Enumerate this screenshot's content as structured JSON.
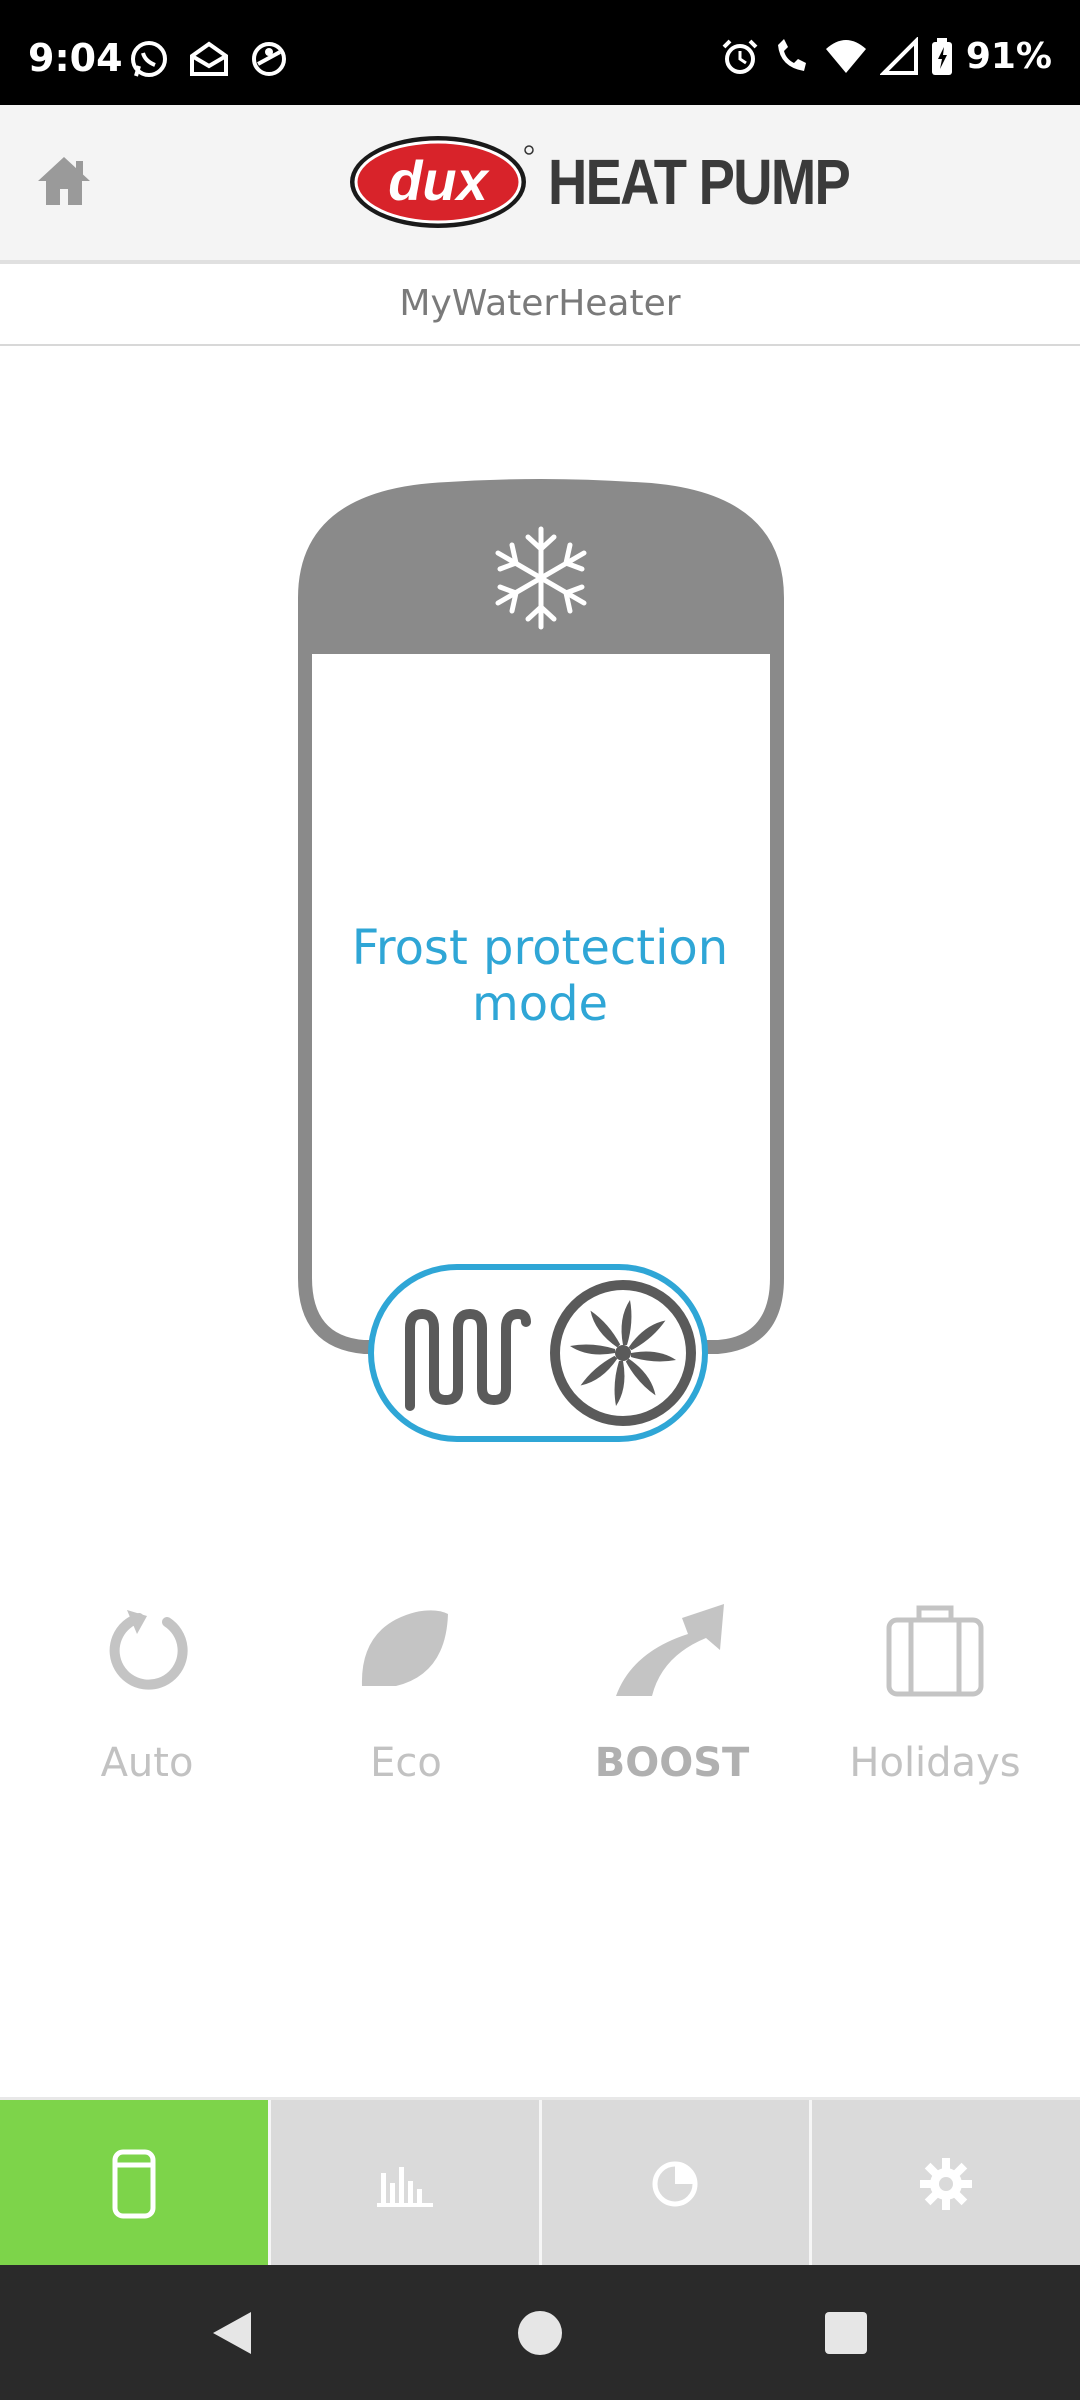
{
  "status_bar": {
    "time": "9:04",
    "battery": "91%",
    "left_icons": [
      "whatsapp-icon",
      "mail-icon",
      "cloud-sync-icon"
    ],
    "right_icons": [
      "alarm-icon",
      "wifi-call-icon",
      "wifi-icon",
      "signal-icon",
      "battery-charging-icon"
    ]
  },
  "header": {
    "home_icon": "home-icon",
    "logo_brand": "dux",
    "logo_text": "HEAT PUMP"
  },
  "device": {
    "name": "MyWaterHeater"
  },
  "tank": {
    "top_icon": "snowflake-icon",
    "status_text": "Frost protection mode",
    "bottom_icons": [
      "heating-coil-icon",
      "fan-icon"
    ],
    "colors": {
      "tank_gray": "#8a8a8a",
      "accent_blue": "#2fa6d6"
    }
  },
  "modes": [
    {
      "label": "Auto",
      "icon": "auto-refresh-icon"
    },
    {
      "label": "Eco",
      "icon": "leaf-icon"
    },
    {
      "label": "BOOST",
      "icon": "boost-arrow-icon"
    },
    {
      "label": "Holidays",
      "icon": "suitcase-icon"
    }
  ],
  "tabs": [
    {
      "icon": "tank-icon",
      "active": true
    },
    {
      "icon": "bar-chart-icon",
      "active": false
    },
    {
      "icon": "pie-chart-icon",
      "active": false
    },
    {
      "icon": "gear-icon",
      "active": false
    }
  ],
  "tab_colors": {
    "active": "#7dd44a",
    "inactive": "#dadada"
  },
  "nav": [
    "back-icon",
    "home-circle-icon",
    "recents-icon"
  ]
}
